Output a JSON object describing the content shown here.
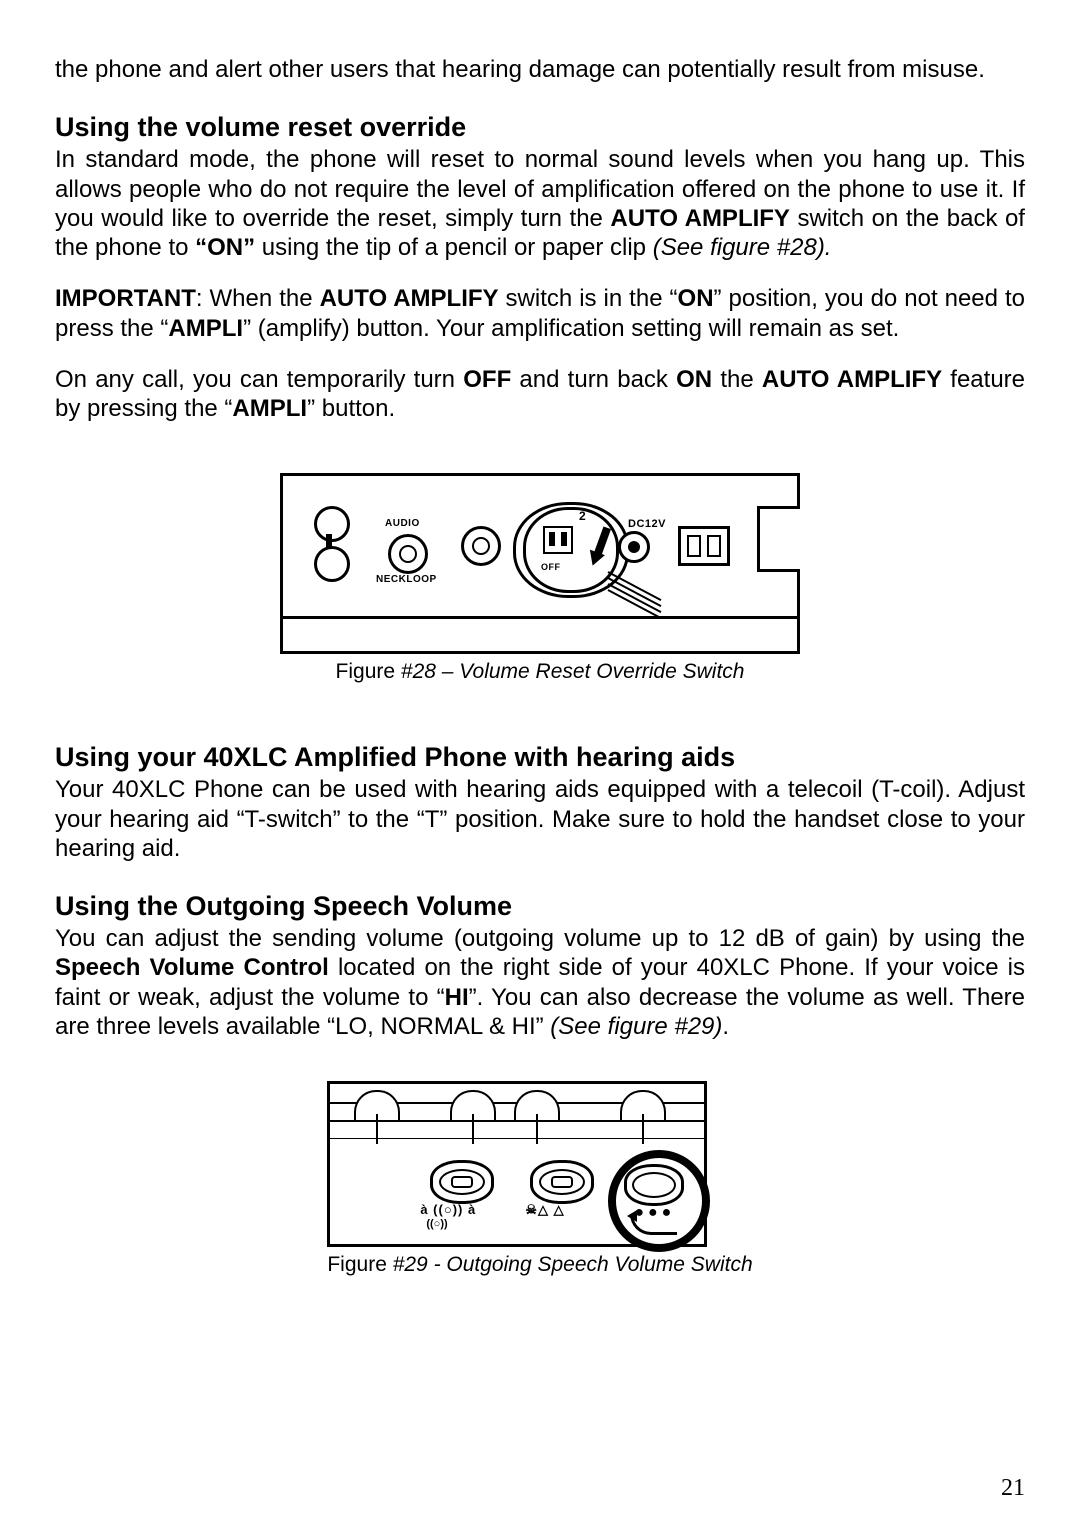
{
  "intro_paragraph": "the phone and alert other users that hearing damage can potentially result from misuse.",
  "section1": {
    "heading": "Using the volume reset override",
    "p1_a": "In standard mode, the phone will reset to normal sound levels when you hang up. This allows people who do not require the level of amplification offered on the phone to use it. If you would like to override the reset, simply turn the ",
    "p1_bold1": "AUTO AMPLIFY",
    "p1_b": " switch on the back of the phone to ",
    "p1_bold2": "“ON”",
    "p1_c": " using the tip of a pencil or paper clip ",
    "p1_italic": "(See figure #28).",
    "p2_bold1": "IMPORTANT",
    "p2_a": ": When the ",
    "p2_bold2": "AUTO AMPLIFY",
    "p2_b": " switch is in the “",
    "p2_bold3": "ON",
    "p2_c": "” position, you do not need to press the “",
    "p2_bold4": "AMPLI",
    "p2_d": "” (amplify) button. Your amplification setting will remain as set.",
    "p3_a": "On any call, you can temporarily turn ",
    "p3_bold1": "OFF",
    "p3_b": " and turn back ",
    "p3_bold2": "ON",
    "p3_c": " the ",
    "p3_bold3": "AUTO AMPLIFY",
    "p3_d": " feature by pressing the “",
    "p3_bold4": "AMPLI",
    "p3_e": "” button."
  },
  "figure28": {
    "caption_prefix": "Figure ",
    "caption_num_italic": "#28 – Volume Reset Override Switch",
    "labels": {
      "audio": "AUDIO",
      "neckloop": "NECKLOOP",
      "dc": "DC12V",
      "off": "OFF",
      "two": "2"
    }
  },
  "section2": {
    "heading": "Using your 40XLC Amplified Phone with hearing aids",
    "p1": "Your 40XLC Phone can be used with hearing aids equipped with a telecoil (T-coil). Adjust your hearing aid “T-switch” to the “T” position.  Make sure to hold the handset close to your hearing aid."
  },
  "section3": {
    "heading": "Using the Outgoing Speech Volume",
    "p1_a": "You can adjust the sending volume (outgoing volume up to 12 dB of gain) by using the ",
    "p1_bold1": "Speech Volume Control",
    "p1_b": " located on the right side of your 40XLC Phone. If your voice is faint or weak, adjust the volume to “",
    "p1_bold2": "HI",
    "p1_c": "”. You can also decrease the volume as well. There are three levels available “LO, NORMAL & HI” ",
    "p1_italic": "(See figure #29)",
    "p1_d": "."
  },
  "figure29": {
    "caption_prefix": "Figure ",
    "caption_num_italic": "#29 - Outgoing Speech Volume Switch",
    "glyph_row1": "à ((○)) à",
    "glyph_row1b": "((○))",
    "glyph_row2": "☠△ △",
    "dots": "●●●"
  },
  "page_number": "21"
}
